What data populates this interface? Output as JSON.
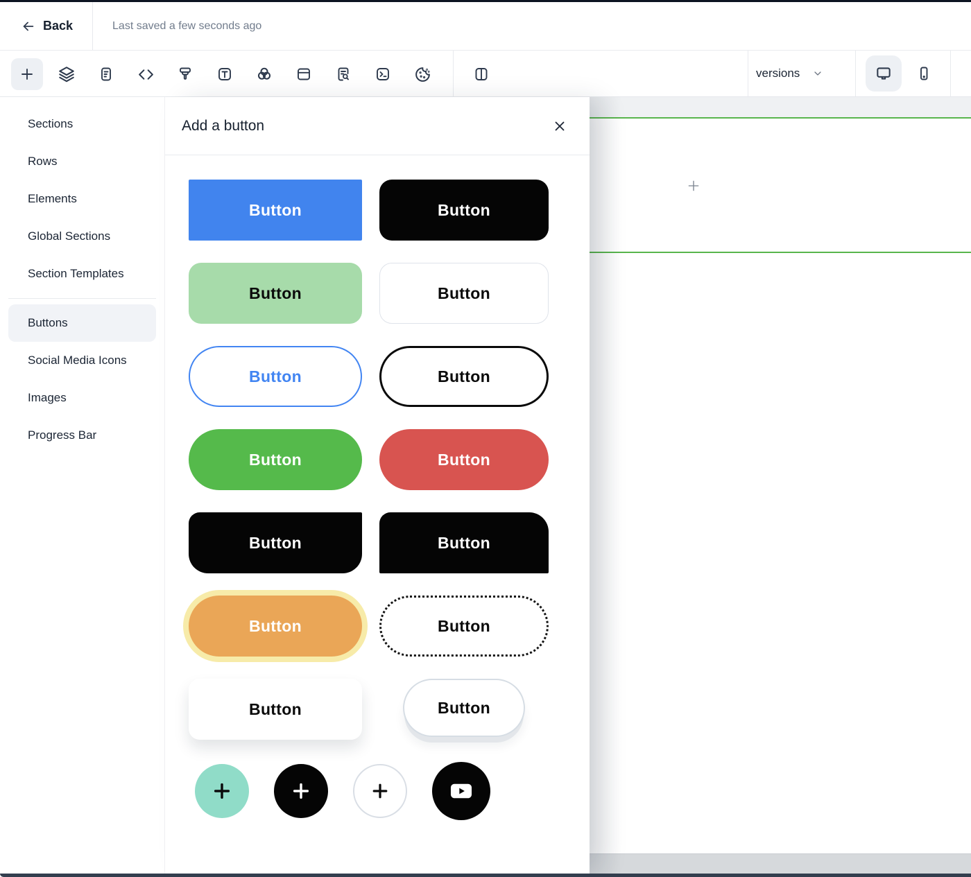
{
  "header": {
    "back_label": "Back",
    "saved_status": "Last saved a few seconds ago"
  },
  "toolbar": {
    "tools": [
      {
        "name": "add",
        "icon": "plus-icon",
        "active": true
      },
      {
        "name": "layers",
        "icon": "layers-icon",
        "active": false
      },
      {
        "name": "document",
        "icon": "document-lines-icon",
        "active": false
      },
      {
        "name": "code",
        "icon": "code-icon",
        "active": false
      },
      {
        "name": "brush",
        "icon": "paintbrush-icon",
        "active": false
      },
      {
        "name": "text",
        "icon": "text-icon",
        "active": false
      },
      {
        "name": "colors",
        "icon": "overlapping-circles-icon",
        "active": false
      },
      {
        "name": "card",
        "icon": "browser-card-icon",
        "active": false
      },
      {
        "name": "file-search",
        "icon": "file-search-icon",
        "active": false
      },
      {
        "name": "terminal",
        "icon": "terminal-icon",
        "active": false
      },
      {
        "name": "cookie",
        "icon": "cookie-icon",
        "active": false
      },
      {
        "name": "split-view",
        "icon": "columns-icon",
        "active": false
      }
    ],
    "versions_label": "versions",
    "devices": [
      {
        "name": "desktop",
        "icon": "monitor-icon",
        "active": true
      },
      {
        "name": "mobile",
        "icon": "smartphone-icon",
        "active": false
      }
    ]
  },
  "sidebar": {
    "items": [
      {
        "label": "Sections",
        "active": false
      },
      {
        "label": "Rows",
        "active": false
      },
      {
        "label": "Elements",
        "active": false
      },
      {
        "label": "Global Sections",
        "active": false
      },
      {
        "label": "Section Templates",
        "active": false
      },
      {
        "label": "Buttons",
        "active": true
      },
      {
        "label": "Social Media Icons",
        "active": false
      },
      {
        "label": "Images",
        "active": false
      },
      {
        "label": "Progress Bar",
        "active": false
      }
    ]
  },
  "panel": {
    "title": "Add a button",
    "buttons": [
      {
        "label": "Button",
        "variant": "solid-blue-square",
        "bg": "#4184ee",
        "text_color": "#ffffff"
      },
      {
        "label": "Button",
        "variant": "solid-black-rounded",
        "bg": "#050505",
        "text_color": "#ffffff"
      },
      {
        "label": "Button",
        "variant": "solid-lightgreen-rounded",
        "bg": "#a7dbaa",
        "text_color": "#0b0b0b"
      },
      {
        "label": "Button",
        "variant": "outline-gray-rounded",
        "bg": "#ffffff",
        "border": "#dfe3ea",
        "text_color": "#0b0b0b"
      },
      {
        "label": "Button",
        "variant": "outline-blue-pill",
        "border": "#4285f2",
        "text_color": "#4285f2"
      },
      {
        "label": "Button",
        "variant": "outline-black-pill",
        "border": "#0a0a0a",
        "text_color": "#0a0a0a"
      },
      {
        "label": "Button",
        "variant": "solid-green-pill",
        "bg": "#55ba4b",
        "text_color": "#ffffff"
      },
      {
        "label": "Button",
        "variant": "solid-red-pill",
        "bg": "#d85450",
        "text_color": "#ffffff"
      },
      {
        "label": "Button",
        "variant": "black-mixed-corners-left",
        "bg": "#050505",
        "text_color": "#ffffff"
      },
      {
        "label": "Button",
        "variant": "black-mixed-corners-right",
        "bg": "#050505",
        "text_color": "#ffffff"
      },
      {
        "label": "Button",
        "variant": "orange-glow-pill",
        "bg": "#eaa657",
        "ring": "#f7eba9",
        "text_color": "#ffffff"
      },
      {
        "label": "Button",
        "variant": "dotted-outline-pill",
        "border": "#141414",
        "text_color": "#0a0a0a"
      },
      {
        "label": "Button",
        "variant": "white-shadow-rounded",
        "bg": "#ffffff",
        "text_color": "#0a0a0a"
      },
      {
        "label": "Button",
        "variant": "white-3d-pill",
        "bg": "#ffffff",
        "border": "#d6dde4",
        "text_color": "#0a0a0a"
      }
    ],
    "icon_buttons": [
      {
        "icon": "plus-icon",
        "variant": "teal-circle",
        "bg": "#90dcc8",
        "icon_color": "#0b0b0b"
      },
      {
        "icon": "plus-icon",
        "variant": "black-circle",
        "bg": "#050505",
        "icon_color": "#ffffff"
      },
      {
        "icon": "plus-icon",
        "variant": "white-outline-circle",
        "bg": "#ffffff",
        "border": "#d9dee5",
        "icon_color": "#0b0b0b"
      },
      {
        "icon": "youtube-icon",
        "variant": "black-circle",
        "bg": "#050505",
        "icon_color": "#ffffff"
      }
    ]
  },
  "canvas": {
    "guide_color": "#58b54c",
    "add_icon": "plus-icon"
  }
}
